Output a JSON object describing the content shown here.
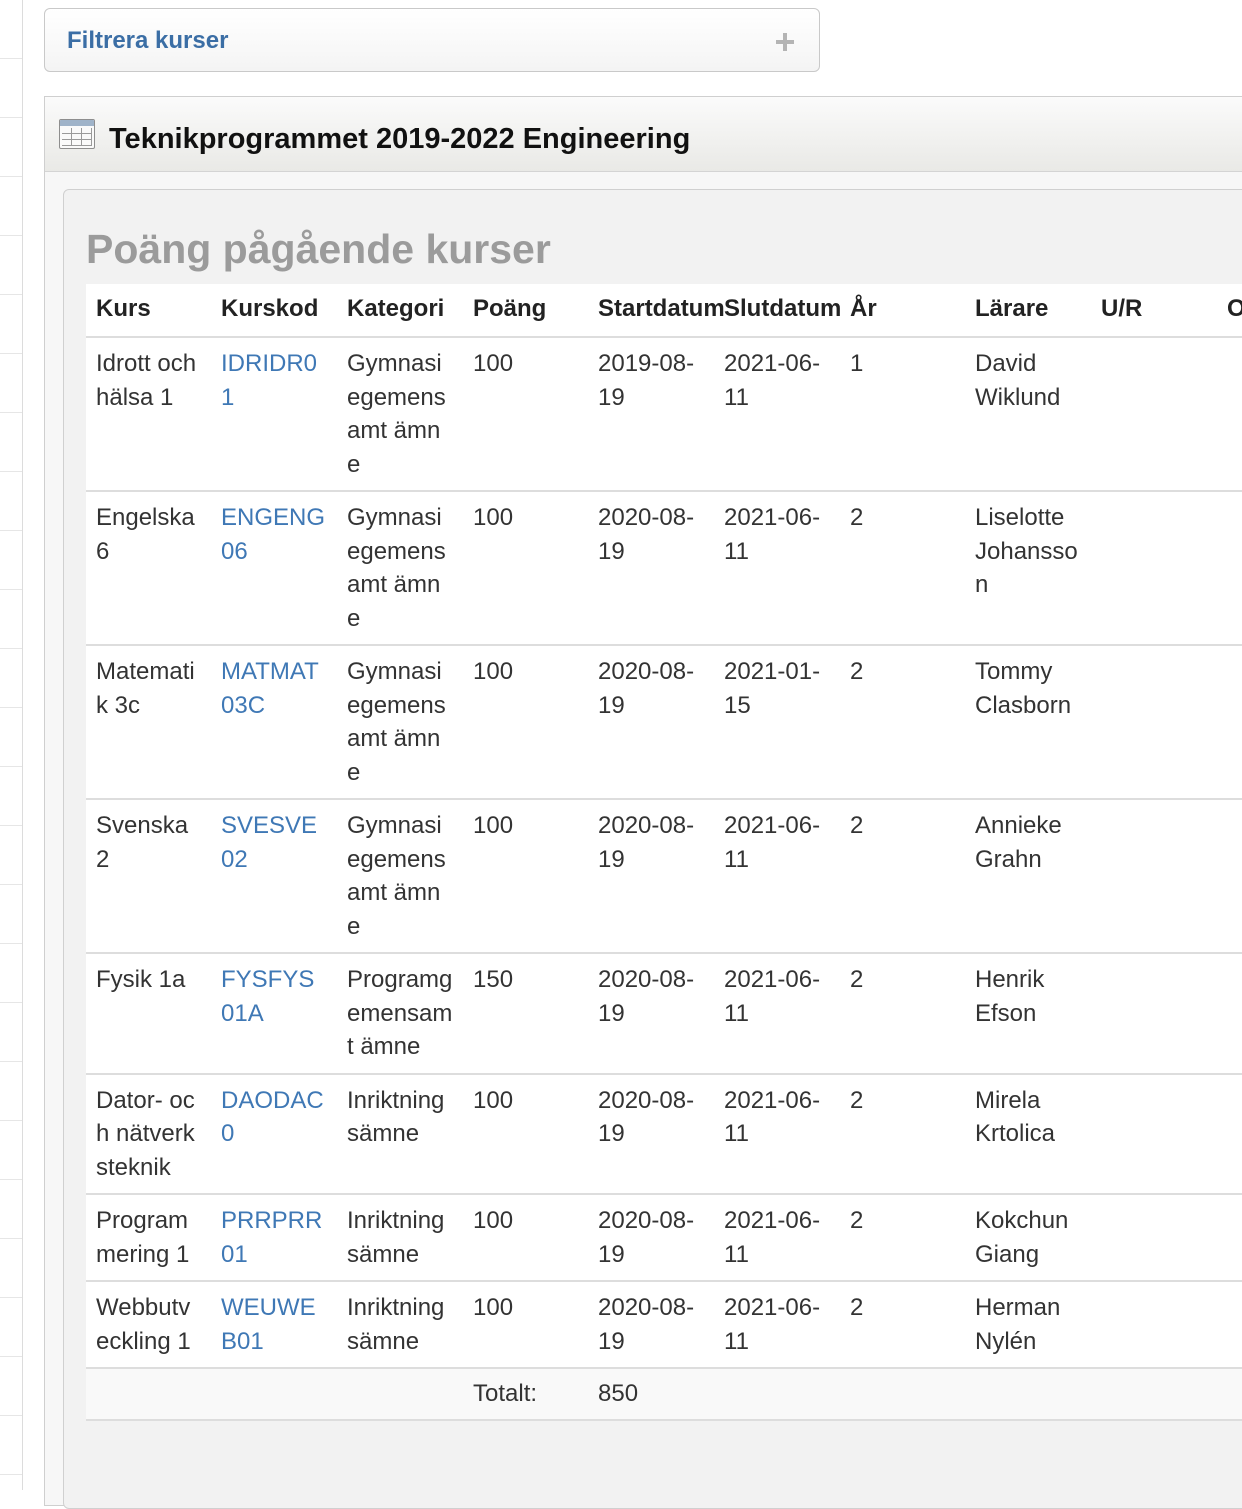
{
  "filter": {
    "title": "Filtrera kurser",
    "toggle_icon": "plus-icon"
  },
  "program": {
    "title": "Teknikprogrammet 2019-2022 Engineering",
    "icon": "table-icon"
  },
  "section": {
    "title": "Poäng pågående kurser"
  },
  "table": {
    "headers": {
      "kurs": "Kurs",
      "kurskod": "Kurskod",
      "kategori": "Kategori",
      "poang": "Poäng",
      "startdatum": "Startdatum",
      "slutdatum": "Slutdatum",
      "ar": "År",
      "larare": "Lärare",
      "ur": "U/R",
      "extra": "O"
    },
    "rows": [
      {
        "kurs": "Idrott och hälsa 1",
        "kurskod": "IDRIDR01",
        "kategori": "Gymnasiegemensamt ämne",
        "poang": "100",
        "startdatum": "2019-08-19",
        "slutdatum": "2021-06-11",
        "ar": "1",
        "larare": "David Wiklund",
        "ur": ""
      },
      {
        "kurs": "Engelska 6",
        "kurskod": "ENGENG06",
        "kategori": "Gymnasiegemensamt ämne",
        "poang": "100",
        "startdatum": "2020-08-19",
        "slutdatum": "2021-06-11",
        "ar": "2",
        "larare": "Liselotte Johansson",
        "ur": ""
      },
      {
        "kurs": "Matematik 3c",
        "kurskod": "MATMAT03C",
        "kategori": "Gymnasiegemensamt ämne",
        "poang": "100",
        "startdatum": "2020-08-19",
        "slutdatum": "2021-01-15",
        "ar": "2",
        "larare": "Tommy Clasborn",
        "ur": ""
      },
      {
        "kurs": "Svenska 2",
        "kurskod": "SVESVE02",
        "kategori": "Gymnasiegemensamt ämne",
        "poang": "100",
        "startdatum": "2020-08-19",
        "slutdatum": "2021-06-11",
        "ar": "2",
        "larare": "Annieke Grahn",
        "ur": ""
      },
      {
        "kurs": "Fysik 1a",
        "kurskod": "FYSFYS01A",
        "kategori": "Programgemensamt ämne",
        "poang": "150",
        "startdatum": "2020-08-19",
        "slutdatum": "2021-06-11",
        "ar": "2",
        "larare": "Henrik Efson",
        "ur": ""
      },
      {
        "kurs": "Dator- och nätverksteknik",
        "kurskod": "DAODAC0",
        "kategori": "Inriktningsämne",
        "poang": "100",
        "startdatum": "2020-08-19",
        "slutdatum": "2021-06-11",
        "ar": "2",
        "larare": "Mirela Krtolica",
        "ur": ""
      },
      {
        "kurs": "Programmering 1",
        "kurskod": "PRRPRR01",
        "kategori": "Inriktningsämne",
        "poang": "100",
        "startdatum": "2020-08-19",
        "slutdatum": "2021-06-11",
        "ar": "2",
        "larare": "Kokchun Giang",
        "ur": ""
      },
      {
        "kurs": "Webbutveckling 1",
        "kurskod": "WEUWEB01",
        "kategori": "Inriktningsämne",
        "poang": "100",
        "startdatum": "2020-08-19",
        "slutdatum": "2021-06-11",
        "ar": "2",
        "larare": "Herman Nylén",
        "ur": ""
      }
    ],
    "total": {
      "label": "Totalt:",
      "value": "850"
    }
  }
}
